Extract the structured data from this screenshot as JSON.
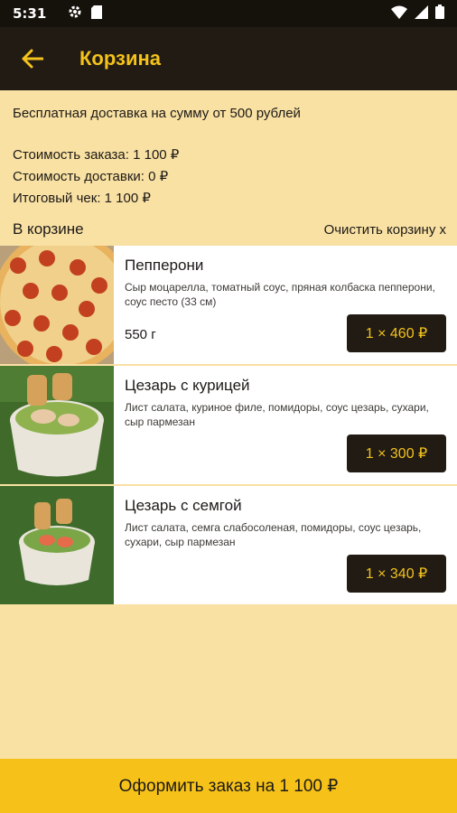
{
  "status": {
    "time": "5:31"
  },
  "appbar": {
    "title": "Корзина"
  },
  "info": {
    "free_delivery": "Бесплатная доставка на сумму от 500 рублей",
    "order_cost": "Стоимость заказа: 1 100 ₽",
    "delivery_cost": "Стоимость доставки: 0 ₽",
    "total": "Итоговый чек: 1 100 ₽"
  },
  "cart": {
    "label": "В корзине",
    "clear": "Очистить корзину x",
    "items": [
      {
        "name": "Пепперони",
        "desc": "Сыр моцарелла, томатный соус, пряная колбаска пепперони, соус песто (33 см)",
        "weight": "550 г",
        "price": "1 × 460 ₽"
      },
      {
        "name": "Цезарь с курицей",
        "desc": "Лист салата, куриное филе, помидоры, соус цезарь, сухари, сыр пармезан",
        "weight": "",
        "price": "1 × 300 ₽"
      },
      {
        "name": "Цезарь с семгой",
        "desc": "Лист салата, семга слабосоленая, помидоры, соус цезарь, сухари, сыр пармезан",
        "weight": "",
        "price": "1 × 340 ₽"
      }
    ]
  },
  "checkout": {
    "label": "Оформить заказ на 1 100 ₽"
  },
  "colors": {
    "accent": "#f3c21b",
    "dark": "#211b14",
    "background": "#f9e1a4"
  }
}
